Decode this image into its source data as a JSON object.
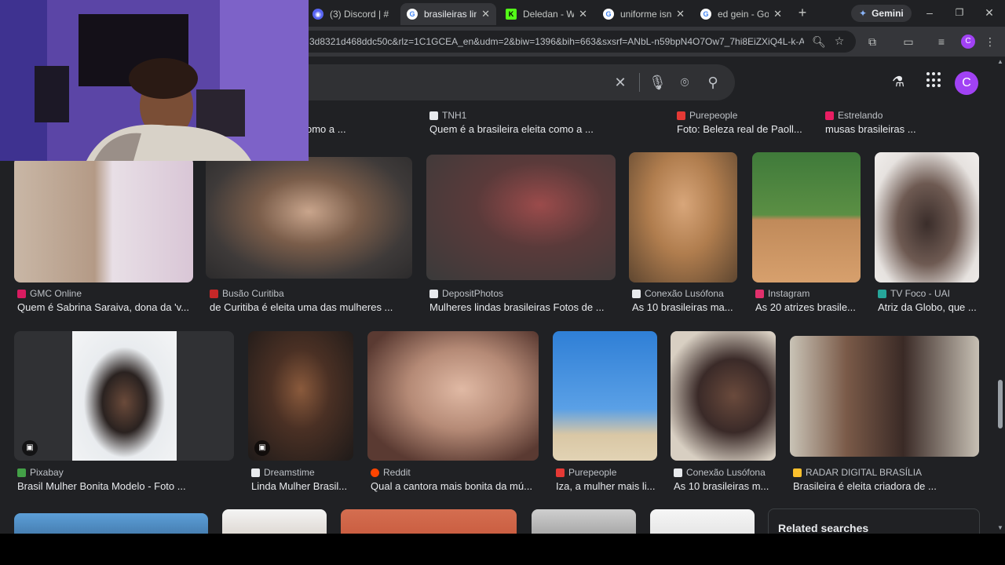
{
  "browser": {
    "tabs": [
      {
        "label": "(3) Discord | #",
        "icon": "discord-icon",
        "color": "#5865f2",
        "active": false
      },
      {
        "label": "brasileiras lind",
        "icon": "google-icon",
        "color": "#4285f4",
        "active": true
      },
      {
        "label": "Deledan - Wat",
        "icon": "kick-icon",
        "color": "#53fc18",
        "active": false
      },
      {
        "label": "uniforme isnti",
        "icon": "google-icon",
        "color": "#4285f4",
        "active": false
      },
      {
        "label": "ed gein - Goog",
        "icon": "google-icon",
        "color": "#4285f4",
        "active": false
      }
    ],
    "gemini_label": "Gemini",
    "url": "3d8321d468ddc50c&rlz=1C1GCEA_en&udm=2&biw=1396&bih=663&sxsrf=ANbL-n59bpN4O7Ow7_7hi8EiZXiQ4L-k-A%...",
    "profile_letter": "C"
  },
  "header": {
    "avatar_letter": "C",
    "accent": "#a142f4"
  },
  "row0": [
    {
      "source": "",
      "caption": "omo a ...",
      "icon_color": "#9aa0a6"
    },
    {
      "source": "TNH1",
      "caption": "Quem é a brasileira eleita como a ...",
      "icon_color": "#e8eaed"
    },
    {
      "source": "Purepeople",
      "caption": "Foto: Beleza real de Paoll...",
      "icon_color": "#e53935"
    },
    {
      "source": "Estrelando",
      "caption": "musas brasileiras ...",
      "icon_color": "#e91e63"
    }
  ],
  "row1": [
    {
      "source": "GMC Online",
      "caption": "Quem é Sabrina Saraiva, dona da 'v...",
      "icon_color": "#d81b60"
    },
    {
      "source": "Busão Curitiba",
      "caption": "de Curitiba é eleita uma das mulheres ...",
      "icon_color": "#c62828"
    },
    {
      "source": "DepositPhotos",
      "caption": "Mulheres lindas brasileiras Fotos de ...",
      "icon_color": "#e8eaed"
    },
    {
      "source": "Conexão Lusófona",
      "caption": "As 10 brasileiras ma...",
      "icon_color": "#e8eaed"
    },
    {
      "source": "Instagram",
      "caption": "As 20 atrizes brasile...",
      "icon_color": "#e1306c"
    },
    {
      "source": "TV Foco - UAI",
      "caption": "Atriz da Globo, que ...",
      "icon_color": "#26a69a"
    }
  ],
  "row2": [
    {
      "source": "Pixabay",
      "caption": "Brasil Mulher Bonita Modelo - Foto ...",
      "icon_color": "#43a047"
    },
    {
      "source": "Dreamstime",
      "caption": "Linda Mulher Brasil...",
      "icon_color": "#e8eaed"
    },
    {
      "source": "Reddit",
      "caption": "Qual a cantora mais bonita da mú...",
      "icon_color": "#ff4500"
    },
    {
      "source": "Purepeople",
      "caption": "Iza, a mulher mais li...",
      "icon_color": "#e53935"
    },
    {
      "source": "Conexão Lusófona",
      "caption": "As 10 brasileiras m...",
      "icon_color": "#e8eaed"
    },
    {
      "source": "RADAR DIGITAL BRASÍLIA",
      "caption": "Brasileira é eleita criadora de ...",
      "icon_color": "#fbc02d"
    }
  ],
  "related_searches": {
    "title": "Related searches"
  }
}
